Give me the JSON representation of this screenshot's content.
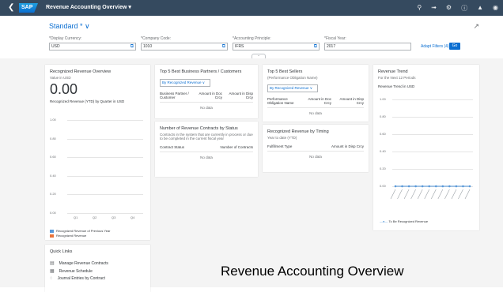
{
  "shell": {
    "back_icon": "chevron-left-icon",
    "logo_text": "SAP",
    "title": "Revenue Accounting Overview ▾"
  },
  "header": {
    "variant_label": "Standard * ∨",
    "share_icon": "share-icon"
  },
  "filters": [
    {
      "label": "*Display Currency:",
      "value": "USD"
    },
    {
      "label": "*Company Code:",
      "value": "1010"
    },
    {
      "label": "*Accounting Principle:",
      "value": "IFRS"
    },
    {
      "label": "*Fiscal Year:",
      "value": "2017"
    }
  ],
  "filter_actions": {
    "adapt": "Adapt Filters (4)",
    "go": "Go"
  },
  "overview": {
    "title": "Recognized Revenue Overview",
    "sub": "Value in USD",
    "value": "0.00",
    "chart_title": "Recognized Revenue (YTD) by Quarter in USD",
    "legend": [
      "Recognized Revenue of Previous Year",
      "Recognized Revenue"
    ],
    "colors": [
      "#5899da",
      "#e8743b"
    ]
  },
  "chart_data": {
    "type": "bar",
    "title": "Recognized Revenue (YTD) by Quarter in USD",
    "categories": [
      "Q1",
      "Q2",
      "Q3",
      "Q4"
    ],
    "series": [
      {
        "name": "Recognized Revenue of Previous Year",
        "values": [
          0,
          0,
          0,
          0
        ]
      },
      {
        "name": "Recognized Revenue",
        "values": [
          0,
          0,
          0,
          0
        ]
      }
    ],
    "yticks": [
      "1.00",
      "0.80",
      "0.60",
      "0.40",
      "0.20",
      "0.00"
    ]
  },
  "partners": {
    "title": "Top 5 Best Business Partners / Customers",
    "select": "By Recognized Revenue",
    "col1": "Business Partner / Customer",
    "col2": "Amount in Doc Crcy",
    "col3": "Amount in Disp Crcy",
    "nodata": "No data"
  },
  "contracts": {
    "title": "Number of Revenue Contracts by Status",
    "sub": "Contracts in the system that are currently in process or due to be completed in the current fiscal year",
    "col1": "Contract Status",
    "col2": "Number of Contracts",
    "nodata": "No data"
  },
  "sellers": {
    "title": "Top 5 Best Sellers",
    "sub": "(Performance Obligation Name)",
    "select": "By Recognized Revenue",
    "col1": "Performance Obligation Name",
    "col2": "Amount in Doc Crcy",
    "col3": "Amount in Disp Crcy",
    "nodata": "No data"
  },
  "timing": {
    "title": "Recognized Revenue by Timing",
    "sub": "Year to date (YTD)",
    "col1": "Fulfillment Type",
    "col2": "Amount in Disp Crcy",
    "nodata": "No data"
  },
  "trend": {
    "title": "Revenue Trend",
    "sub": "For the Next 12 Periods",
    "chart_label": "Revenue Trend in USD",
    "legend": "To Be Recognized Revenue",
    "yticks": [
      "1.00",
      "0.80",
      "0.60",
      "0.40",
      "0.20",
      "0.00"
    ]
  },
  "quicklinks": {
    "title": "Quick Links",
    "items": [
      "Manage Revenue Contracts",
      "Revenue Schedule",
      "Journal Entries by Contract"
    ]
  },
  "overlay_text": "Revenue Accounting Overview"
}
